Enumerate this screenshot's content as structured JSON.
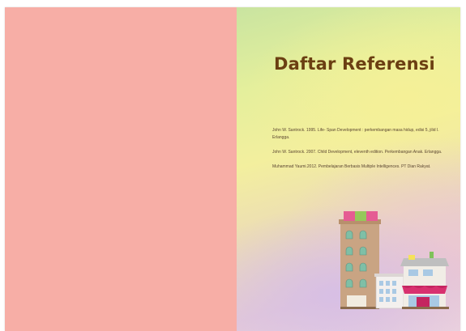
{
  "page": {
    "title": "Daftar Referensi"
  },
  "references": [
    "John W. Santrock. 1995. Life- Span Development : perkembangan masa hidup, edisi 5, jilid I. Erlangga.",
    "John W. Santrock. 2007. Child Development, eleventh edition. Perkembangan Anak. Erlangga.",
    "Muhammad Yaumi.2012. Pembelajaran Berbasis Multiple Intelligences. PT Dian Rakyat."
  ],
  "colors": {
    "left_page": "#f7aea6",
    "title": "#6b3f12",
    "text": "#5b4631"
  },
  "icons": {
    "illustration": "buildings-illustration"
  }
}
